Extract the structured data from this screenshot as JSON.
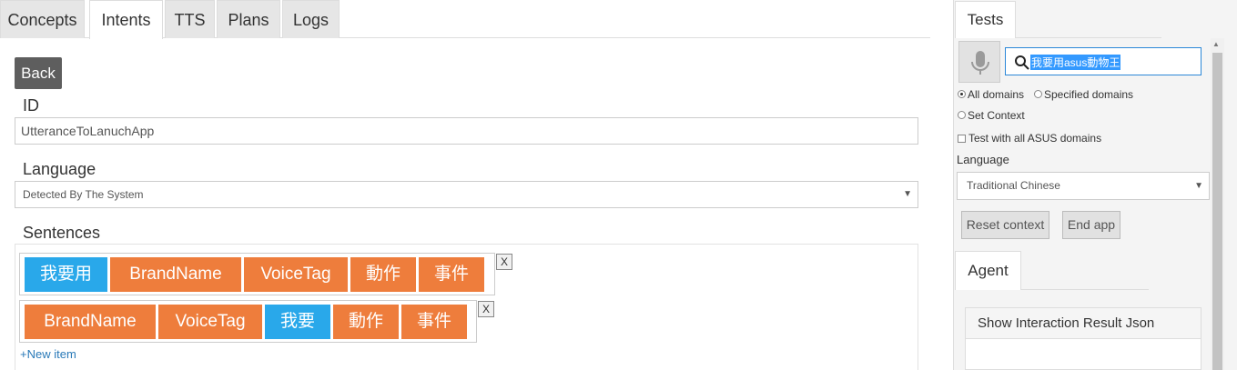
{
  "tabs": [
    {
      "label": "Concepts",
      "active": false
    },
    {
      "label": "Intents",
      "active": true
    },
    {
      "label": "TTS",
      "active": false
    },
    {
      "label": "Plans",
      "active": false
    },
    {
      "label": "Logs",
      "active": false
    }
  ],
  "form": {
    "back_label": "Back",
    "id_label": "ID",
    "id_value": "UtteranceToLanuchApp",
    "language_label": "Language",
    "language_value": "Detected By The System",
    "sentences_label": "Sentences",
    "sentences": [
      {
        "chips": [
          {
            "text": "我要用",
            "color": "blue"
          },
          {
            "text": "BrandName",
            "color": "orange"
          },
          {
            "text": "VoiceTag",
            "color": "orange"
          },
          {
            "text": "動作",
            "color": "orange"
          },
          {
            "text": "事件",
            "color": "orange"
          }
        ]
      },
      {
        "chips": [
          {
            "text": "BrandName",
            "color": "orange"
          },
          {
            "text": "VoiceTag",
            "color": "orange"
          },
          {
            "text": "我要",
            "color": "blue"
          },
          {
            "text": "動作",
            "color": "orange"
          },
          {
            "text": "事件",
            "color": "orange"
          }
        ]
      }
    ],
    "remove_label": "X",
    "new_item_label": "+New item"
  },
  "panel": {
    "tests_tab": "Tests",
    "search_value": "我要用asus動物王",
    "all_domains": "All domains",
    "specified_domains": "Specified domains",
    "set_context": "Set Context",
    "test_all_asus": "Test with all ASUS domains",
    "language_label": "Language",
    "language_value": "Traditional Chinese",
    "reset_context": "Reset context",
    "end_app": "End app",
    "agent_tab": "Agent",
    "show_result": "Show Interaction Result Json"
  },
  "colors": {
    "blue": "#29a8ea",
    "orange": "#ee7d3c",
    "back": "#5e5e5e"
  }
}
